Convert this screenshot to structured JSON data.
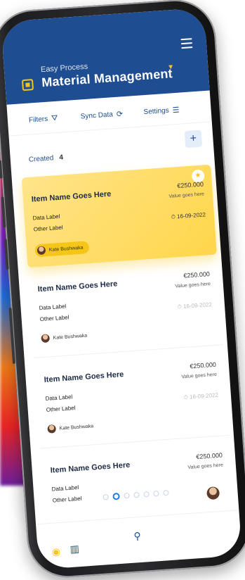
{
  "header": {
    "subtitle": "Easy Process",
    "title": "Material Management",
    "chevron_icon": "chevron-down-icon",
    "menu_icon": "hamburger-icon",
    "logo_icon": "app-logo-icon"
  },
  "toolbar": {
    "filters": "Filters",
    "sync": "Sync Data",
    "settings": "Settings"
  },
  "list": {
    "created_label": "Created",
    "created_count": "4",
    "add_label": "+"
  },
  "cards": [
    {
      "title": "Item Name Goes Here",
      "price": "€250.000",
      "value": "Value goes here",
      "label1": "Data Label",
      "label2": "Other Label",
      "date": "16-09-2022",
      "user": "Kate Bushwaka"
    },
    {
      "title": "Item Name Goes Here",
      "price": "€250.000",
      "value": "Value goes here",
      "label1": "Data Label",
      "label2": "Other Label",
      "date": "16-09-2022",
      "user": "Kate Bushwaka"
    },
    {
      "title": "Item Name Goes Here",
      "price": "€250.000",
      "value": "Value goes here",
      "label1": "Data Label",
      "label2": "Other Label",
      "date": "16-09-2022",
      "user": "Kate Bushwaka"
    },
    {
      "title": "Item Name Goes Here",
      "price": "€250.000",
      "value": "Value goes here",
      "label1": "Data Label",
      "label2": "Other Label"
    }
  ],
  "pager": {
    "total": 7,
    "active_index": 1
  },
  "colors": {
    "brand": "#1f4d91",
    "accent": "#f5c518",
    "active_dot": "#1f7be0"
  }
}
